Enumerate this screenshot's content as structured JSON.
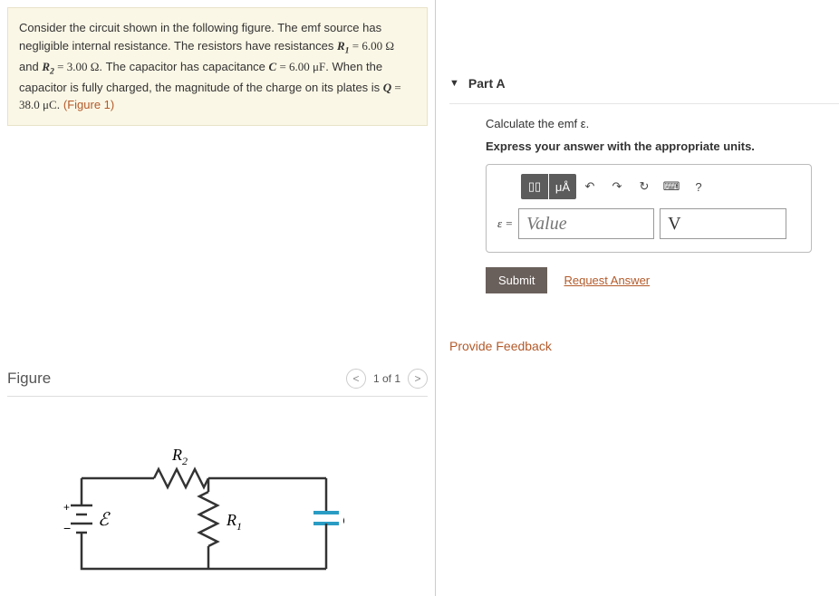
{
  "problem": {
    "intro": "Consider the circuit shown in the following figure. The emf source has negligible internal resistance. The resistors have resistances ",
    "r1_label": "R",
    "r1_sub": "1",
    "r1_val": " = 6.00 Ω",
    "and": " and ",
    "r2_label": "R",
    "r2_sub": "2",
    "r2_val": " = 3.00 Ω",
    "cap_sentence": ". The capacitor has capacitance ",
    "c_label": "C",
    "c_val": " = 6.00 μF",
    "charge_sentence": ". When the capacitor is fully charged, the magnitude of the charge on its plates is ",
    "q_label": "Q",
    "q_val": " = 38.0 μC",
    "fig_ref": "(Figure 1)"
  },
  "figure": {
    "heading": "Figure",
    "page_indicator": "1 of 1",
    "labels": {
      "r2": "R",
      "r2_sub": "2",
      "r1": "R",
      "r1_sub": "1",
      "c": "C",
      "emf": "ℰ"
    }
  },
  "partA": {
    "title": "Part A",
    "q_prompt": "Calculate the emf ε.",
    "units_prompt": "Express your answer with the appropriate units.",
    "toolbar": {
      "templates": "▯▯",
      "micro": "μÅ",
      "undo": "↶",
      "redo": "↷",
      "reset": "↻",
      "keyboard": "⌨",
      "help": "?"
    },
    "answer": {
      "var_label": "ε =",
      "value_placeholder": "Value",
      "unit_value": "V"
    },
    "submit": "Submit",
    "request": "Request Answer"
  },
  "feedback": "Provide Feedback"
}
